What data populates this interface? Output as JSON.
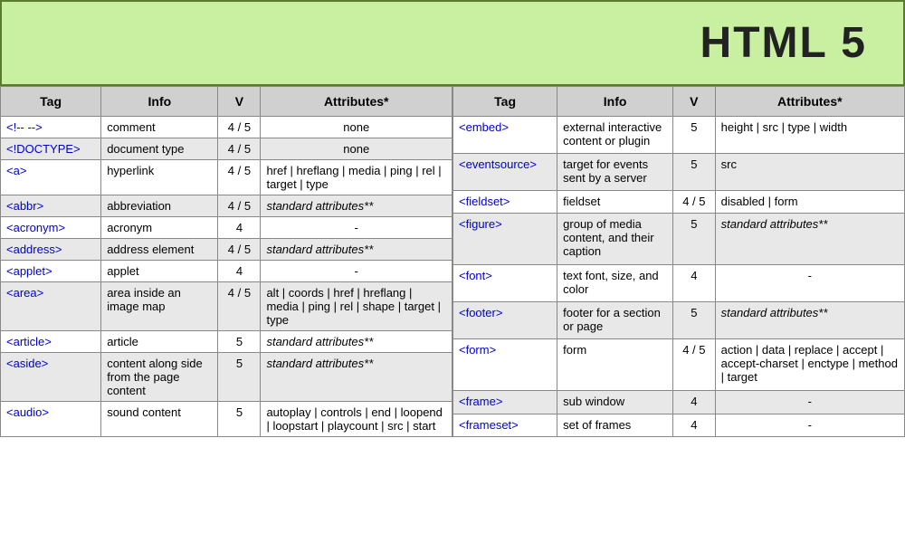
{
  "header": {
    "title": "HTML 5"
  },
  "left_table": {
    "columns": [
      "Tag",
      "Info",
      "V",
      "Attributes*"
    ],
    "rows": [
      {
        "tag": "<!-- -->",
        "info": "comment",
        "v": "4 / 5",
        "attrs": "none",
        "tag_colored": true,
        "italic_attrs": false,
        "gray": false
      },
      {
        "tag": "<!DOCTYPE>",
        "info": "document type",
        "v": "4 / 5",
        "attrs": "none",
        "tag_colored": true,
        "italic_attrs": false,
        "gray": true
      },
      {
        "tag": "<a>",
        "info": "hyperlink",
        "v": "4 / 5",
        "attrs": "href | hreflang | media | ping | rel | target | type",
        "tag_colored": true,
        "italic_attrs": false,
        "gray": false
      },
      {
        "tag": "<abbr>",
        "info": "abbreviation",
        "v": "4 / 5",
        "attrs": "standard attributes**",
        "tag_colored": true,
        "italic_attrs": true,
        "gray": true
      },
      {
        "tag": "<acronym>",
        "info": "acronym",
        "v": "4",
        "attrs": "-",
        "tag_colored": true,
        "italic_attrs": false,
        "gray": false
      },
      {
        "tag": "<address>",
        "info": "address element",
        "v": "4 / 5",
        "attrs": "standard attributes**",
        "tag_colored": true,
        "italic_attrs": true,
        "gray": true
      },
      {
        "tag": "<applet>",
        "info": "applet",
        "v": "4",
        "attrs": "-",
        "tag_colored": true,
        "italic_attrs": false,
        "gray": false
      },
      {
        "tag": "<area>",
        "info": "area inside an image map",
        "v": "4 / 5",
        "attrs": "alt | coords | href | hreflang | media | ping | rel | shape | target | type",
        "tag_colored": true,
        "italic_attrs": false,
        "gray": true
      },
      {
        "tag": "<article>",
        "info": "article",
        "v": "5",
        "attrs": "standard attributes**",
        "tag_colored": true,
        "italic_attrs": true,
        "gray": false
      },
      {
        "tag": "<aside>",
        "info": "content along side from the page content",
        "v": "5",
        "attrs": "standard attributes**",
        "tag_colored": true,
        "italic_attrs": true,
        "gray": true
      },
      {
        "tag": "<audio>",
        "info": "sound content",
        "v": "5",
        "attrs": "autoplay | controls | end | loopend | loopstart | playcount | src | start",
        "tag_colored": true,
        "italic_attrs": false,
        "gray": false
      }
    ]
  },
  "right_table": {
    "columns": [
      "Tag",
      "Info",
      "V",
      "Attributes*"
    ],
    "rows": [
      {
        "tag": "<embed>",
        "info": "external interactive content or plugin",
        "v": "5",
        "attrs": "height | src | type | width",
        "tag_colored": true,
        "italic_attrs": false,
        "gray": false
      },
      {
        "tag": "<eventsource>",
        "info": "target for events sent by a server",
        "v": "5",
        "attrs": "src",
        "tag_colored": true,
        "italic_attrs": false,
        "gray": true
      },
      {
        "tag": "<fieldset>",
        "info": "fieldset",
        "v": "4 / 5",
        "attrs": "disabled | form",
        "tag_colored": true,
        "italic_attrs": false,
        "gray": false
      },
      {
        "tag": "<figure>",
        "info": "group of media content, and their caption",
        "v": "5",
        "attrs": "standard attributes**",
        "tag_colored": true,
        "italic_attrs": true,
        "gray": true
      },
      {
        "tag": "<font>",
        "info": "text font, size, and color",
        "v": "4",
        "attrs": "-",
        "tag_colored": true,
        "italic_attrs": false,
        "gray": false
      },
      {
        "tag": "<footer>",
        "info": "footer for a section or page",
        "v": "5",
        "attrs": "standard attributes**",
        "tag_colored": true,
        "italic_attrs": true,
        "gray": true
      },
      {
        "tag": "<form>",
        "info": "form",
        "v": "4 / 5",
        "attrs": "action | data | replace | accept | accept-charset | enctype | method | target",
        "tag_colored": true,
        "italic_attrs": false,
        "gray": false
      },
      {
        "tag": "<frame>",
        "info": "sub window",
        "v": "4",
        "attrs": "-",
        "tag_colored": true,
        "italic_attrs": false,
        "gray": true
      },
      {
        "tag": "<frameset>",
        "info": "set of frames",
        "v": "4",
        "attrs": "-",
        "tag_colored": true,
        "italic_attrs": false,
        "gray": false
      }
    ]
  }
}
